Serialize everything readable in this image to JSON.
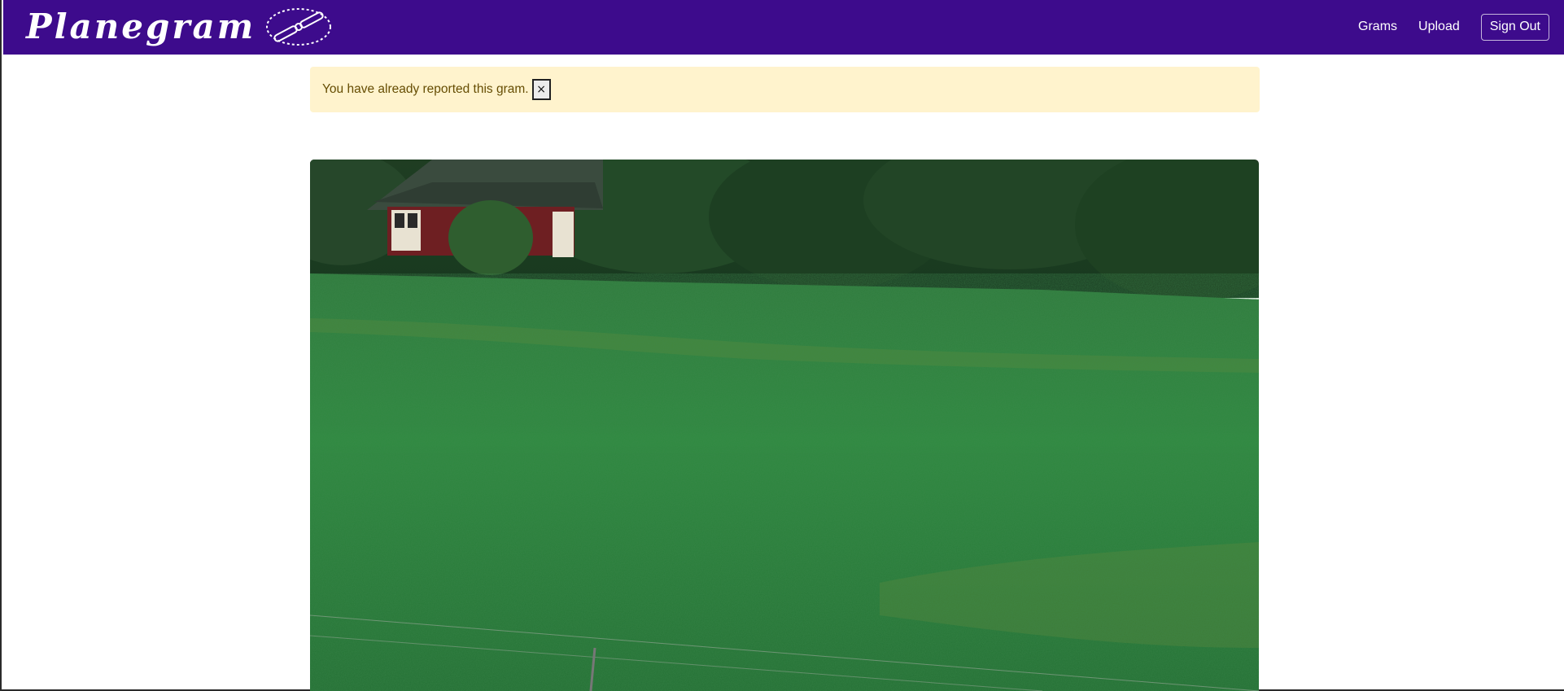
{
  "app": {
    "brand_name": "Planegram",
    "logo_icon": "airplane-propeller-logo-icon",
    "nav_color": "#3d0b8c"
  },
  "nav": {
    "links": [
      {
        "label": "Grams"
      },
      {
        "label": "Upload"
      }
    ],
    "sign_out_label": "Sign Out"
  },
  "alert": {
    "message": "You have already reported this gram.",
    "close_label": "×",
    "background_color": "#fff3cd"
  },
  "gram": {
    "image_icon": "landscape-photo-green-field-red-house"
  }
}
